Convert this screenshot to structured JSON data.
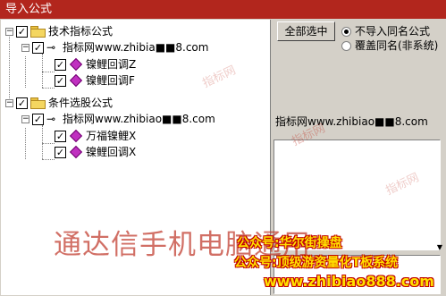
{
  "window": {
    "title": "导入公式"
  },
  "tree": {
    "group1": {
      "label": "技术指标公式"
    },
    "group1_sub": {
      "label": "指标网www.zhibia■■8.com"
    },
    "group1_items": [
      {
        "label": "镍鲤回调Z"
      },
      {
        "label": "镍鲤回调F"
      }
    ],
    "group2": {
      "label": "条件选股公式"
    },
    "group2_sub": {
      "label": "指标网www.zhibiao■■8.com"
    },
    "group2_items": [
      {
        "label": "万福镍鲤X"
      },
      {
        "label": "镍鲤回调X"
      }
    ]
  },
  "buttons": {
    "select_all": "全部选中"
  },
  "options": {
    "no_import": "不导入同名公式",
    "overwrite": "覆盖同名(非系统)"
  },
  "info_text": "指标网www.zhibiao■■8.com",
  "overlay": {
    "banner": "通达信手机电脑通用",
    "line1": "公众号:华尔街操盘",
    "line2": "公众号:顶级游资量化T板系统",
    "site": "www.zhibiao888.com",
    "wm_small": "指标网"
  },
  "colors": {
    "title_bar": "#b2261d",
    "watermark_red": "#c0392b",
    "promo_yellow": "#ffe000"
  }
}
